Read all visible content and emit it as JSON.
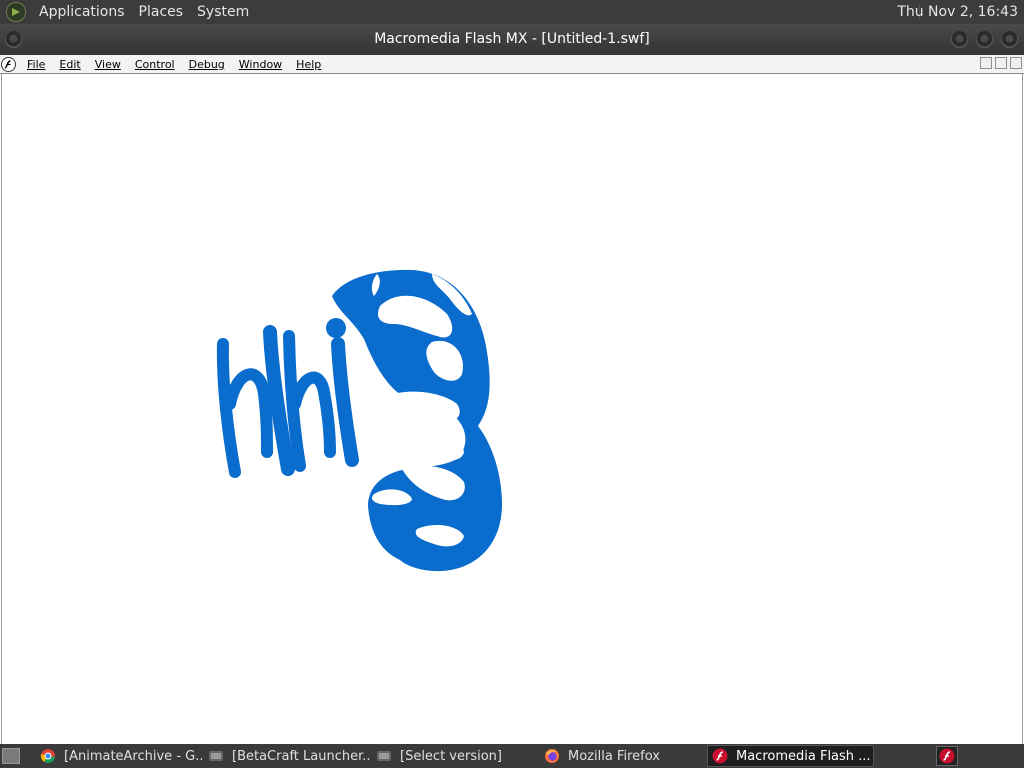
{
  "top_panel": {
    "menus": [
      "Applications",
      "Places",
      "System"
    ],
    "clock": "Thu Nov  2, 16:43"
  },
  "window": {
    "title": "Macromedia Flash MX - [Untitled-1.swf]"
  },
  "menubar": {
    "items": [
      "File",
      "Edit",
      "View",
      "Control",
      "Debug",
      "Window",
      "Help"
    ]
  },
  "stage": {
    "shape_color": "#0a6ccc"
  },
  "taskbar": {
    "tasks": [
      {
        "label": "[AnimateArchive - G...",
        "icon": "chrome-icon"
      },
      {
        "label": "[BetaCraft Launcher...",
        "icon": "java-icon"
      },
      {
        "label": "[Select version]",
        "icon": "java-icon"
      },
      {
        "label": "Mozilla Firefox",
        "icon": "firefox-icon"
      },
      {
        "label": "Macromedia Flash ...",
        "icon": "flash-icon"
      }
    ]
  }
}
